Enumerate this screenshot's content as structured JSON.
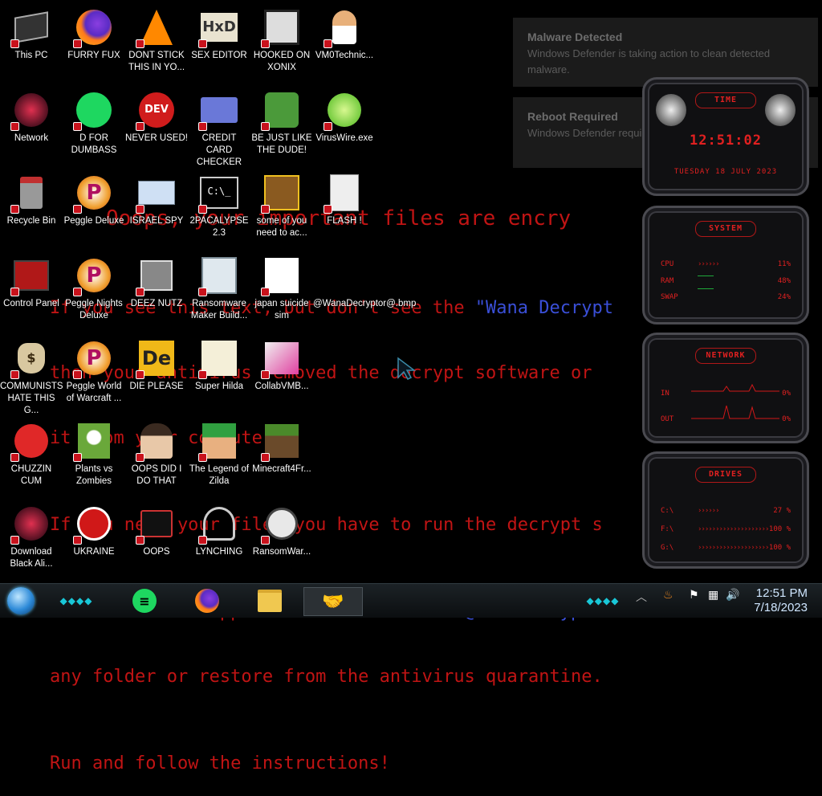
{
  "wallpaper": {
    "line1": "Ooops, your important files are encry",
    "line2a": "If you see this text, but don't see the ",
    "line2b": "\"Wana Decrypt",
    "line3": "then your antivirus removed the decrypt software or",
    "line4": "it from your computer.",
    "line5": "If you need your files you have to run the decrypt s",
    "line6a": "Please find an application file named ",
    "line6b": "\"@WanaDecrypto",
    "line7": "any folder or restore from the antivirus quarantine.",
    "line8": "Run and follow the instructions!"
  },
  "notifications": [
    {
      "title": "Malware Detected",
      "message": "Windows Defender is taking action to clean detected malware."
    },
    {
      "title": "Reboot Required",
      "message": "Windows Defender requires a reboot to finish malware"
    }
  ],
  "icons": [
    {
      "label": "This PC",
      "icon": "computer-icon"
    },
    {
      "label": "FURRY FUX",
      "icon": "firefox-icon"
    },
    {
      "label": "DONT STICK THIS IN YO...",
      "icon": "vlc-cone-icon"
    },
    {
      "label": "SEX EDITOR",
      "icon": "hex-editor-icon"
    },
    {
      "label": "HOOKED ON XONIX",
      "icon": "xonix-icon"
    },
    {
      "label": "VM0Technic...",
      "icon": "doctor-icon"
    },
    {
      "label": "Network",
      "icon": "alien-network-icon"
    },
    {
      "label": "D FOR DUMBASS",
      "icon": "spotify-icon"
    },
    {
      "label": "NEVER USED!",
      "icon": "dev-cpp-icon"
    },
    {
      "label": "CREDIT CARD CHECKER",
      "icon": "credit-card-icon"
    },
    {
      "label": "BE JUST LIKE THE DUDE!",
      "icon": "elf-icon"
    },
    {
      "label": "VirusWire.exe",
      "icon": "lime-icon"
    },
    {
      "label": "Recycle Bin",
      "icon": "recycle-bin-icon"
    },
    {
      "label": "Peggle Deluxe",
      "icon": "peggle-icon"
    },
    {
      "label": "ISRAEL SPY",
      "icon": "network-spy-icon"
    },
    {
      "label": "2PACALYPSE 2.3",
      "icon": "terminal-icon"
    },
    {
      "label": "some of you need to ac...",
      "icon": "dog-icon"
    },
    {
      "label": "FLASH !",
      "icon": "flash-file-icon"
    },
    {
      "label": "Control Panel",
      "icon": "control-panel-icon"
    },
    {
      "label": "Peggle Nights Deluxe",
      "icon": "peggle-icon"
    },
    {
      "label": "DEEZ NUTZ",
      "icon": "windows-stack-icon"
    },
    {
      "label": "Ransomware Maker Build...",
      "icon": "app-window-icon"
    },
    {
      "label": "japan suicide sim",
      "icon": "document-icon"
    },
    {
      "label": "@WanaDecryptor@.bmp",
      "icon": "bitmap-icon"
    },
    {
      "label": "COMMUNISTS HATE THIS G...",
      "icon": "money-bag-icon"
    },
    {
      "label": "Peggle World of Warcraft ...",
      "icon": "peggle-icon"
    },
    {
      "label": "DIE PLEASE",
      "icon": "de-icon"
    },
    {
      "label": "Super Hilda",
      "icon": "pixel-dog-icon"
    },
    {
      "label": "CollabVMB...",
      "icon": "collab-icon"
    },
    {
      "label": "CHUZZIN CUM",
      "icon": "chuzzle-icon"
    },
    {
      "label": "Plants vs Zombies",
      "icon": "flower-icon"
    },
    {
      "label": "OOPS DID I DO THAT",
      "icon": "portrait-icon"
    },
    {
      "label": "The Legend of Zilda",
      "icon": "pixel-hero-icon"
    },
    {
      "label": "Minecraft4Fr...",
      "icon": "grass-block-icon"
    },
    {
      "label": "Download Black Ali...",
      "icon": "alien-network-icon"
    },
    {
      "label": "UKRAINE",
      "icon": "radiation-icon"
    },
    {
      "label": "OOPS",
      "icon": "computer-dark-icon"
    },
    {
      "label": "LYNCHING",
      "icon": "lynching-icon"
    },
    {
      "label": "RansomWar...",
      "icon": "skull-icon"
    }
  ],
  "gadgets": {
    "time": {
      "title": "TIME",
      "clock": "12:51:02",
      "date": "TUESDAY 18 JULY 2023"
    },
    "system": {
      "title": "SYSTEM",
      "rows": [
        {
          "key": "CPU",
          "bars": "››››››",
          "value": "11%"
        },
        {
          "key": "RAM",
          "bars": "",
          "value": "48%"
        },
        {
          "key": "SWAP",
          "bars": "",
          "value": "24%"
        }
      ]
    },
    "network": {
      "title": "NETWORK",
      "rows": [
        {
          "key": "IN",
          "value": "0%"
        },
        {
          "key": "OUT",
          "value": "0%"
        }
      ]
    },
    "drives": {
      "title": "DRIVES",
      "rows": [
        {
          "key": "C:\\",
          "bars": "››››››",
          "value": "27 %"
        },
        {
          "key": "F:\\",
          "bars": "››››››››››››››››››››",
          "value": "100 %"
        },
        {
          "key": "G:\\",
          "bars": "››››››››››››››››››››",
          "value": "100 %"
        }
      ]
    }
  },
  "taskbar": {
    "clock_time": "12:51 PM",
    "clock_date": "7/18/2023",
    "pinned": [
      "spotify-icon",
      "firefox-icon",
      "file-explorer-icon",
      "handshake-icon"
    ],
    "tray": [
      "up-chevron-icon",
      "java-icon",
      "notification-flag-icon",
      "network-icon",
      "speaker-icon"
    ]
  },
  "colors": {
    "accent_red": "#e02020",
    "ransom_red": "#c01414",
    "ransom_blue": "#3a4fd8"
  }
}
